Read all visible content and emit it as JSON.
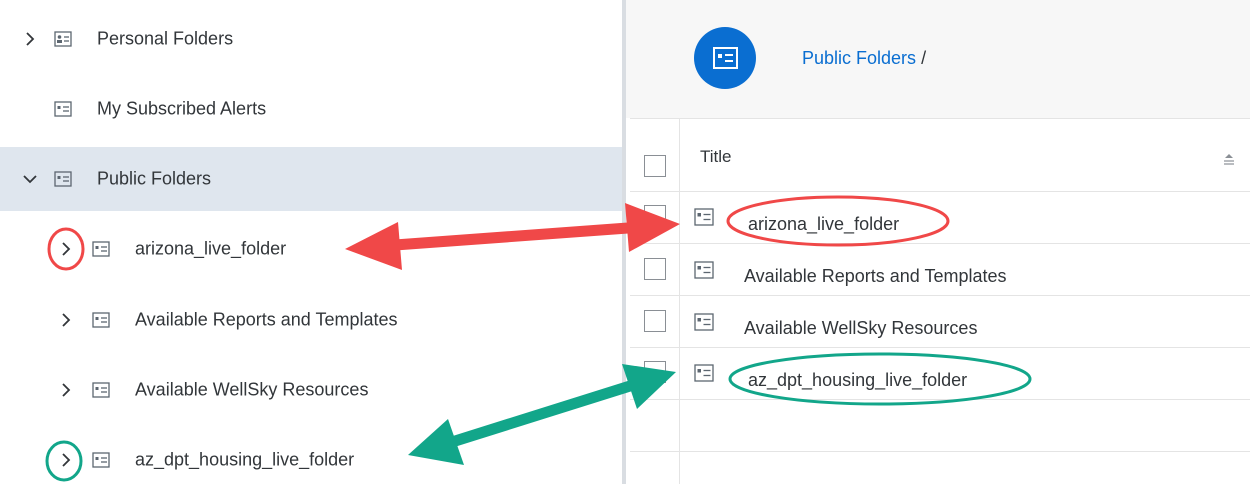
{
  "tree": {
    "items": [
      {
        "label": "Personal Folders",
        "icon": "personal-folder-icon",
        "chevron": "right"
      },
      {
        "label": "My Subscribed Alerts",
        "icon": "alerts-folder-icon",
        "chevron": "none"
      },
      {
        "label": "Public Folders",
        "icon": "folder-icon",
        "chevron": "down",
        "selected": true
      },
      {
        "label": "arizona_live_folder",
        "icon": "folder-icon",
        "chevron": "right"
      },
      {
        "label": "Available Reports and Templates",
        "icon": "folder-icon",
        "chevron": "right"
      },
      {
        "label": "Available WellSky Resources",
        "icon": "folder-icon",
        "chevron": "right"
      },
      {
        "label": "az_dpt_housing_live_folder",
        "icon": "folder-icon",
        "chevron": "right"
      }
    ]
  },
  "breadcrumb": {
    "current": "Public Folders",
    "separator": "/"
  },
  "table": {
    "column_title": "Title",
    "rows": [
      {
        "title": "arizona_live_folder"
      },
      {
        "title": "Available Reports and Templates"
      },
      {
        "title": "Available WellSky Resources"
      },
      {
        "title": "az_dpt_housing_live_folder"
      }
    ]
  },
  "colors": {
    "accent": "#0a6ed1",
    "selected_row": "#dfe6ee",
    "annotation_red": "#f04848",
    "annotation_teal": "#12a68a"
  }
}
